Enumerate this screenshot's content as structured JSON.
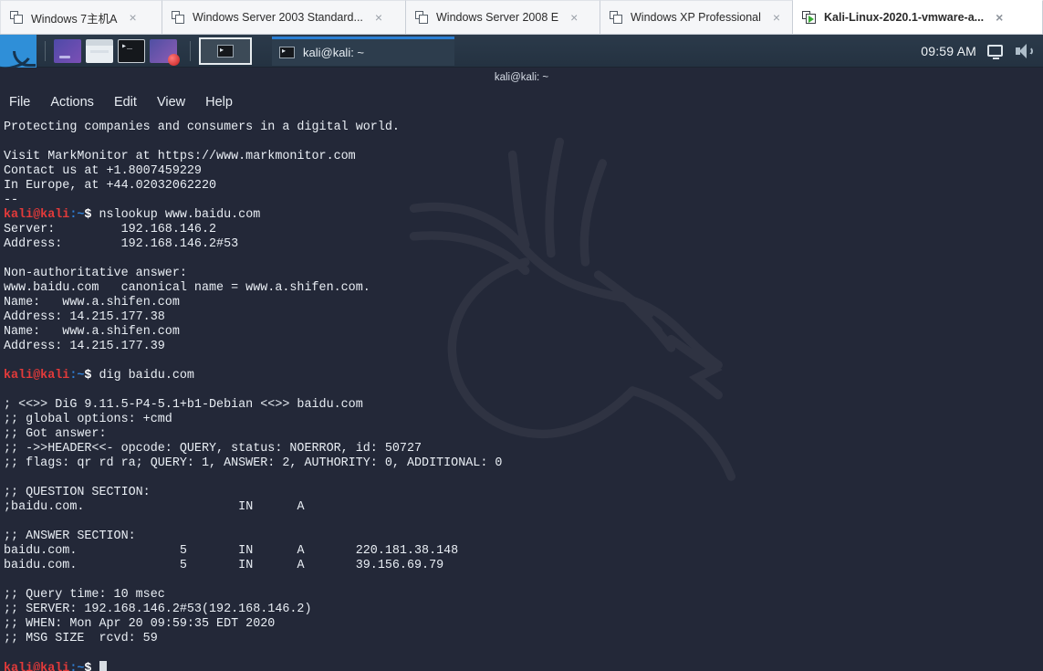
{
  "vmware_tabs": [
    {
      "label": "Windows 7主机A",
      "icon": "window-icon",
      "active": false,
      "close": "×"
    },
    {
      "label": "Windows Server 2003 Standard...",
      "icon": "window-icon",
      "active": false,
      "close": "×"
    },
    {
      "label": "Windows Server 2008 E",
      "icon": "window-icon",
      "active": false,
      "close": "×"
    },
    {
      "label": "Windows XP Professional",
      "icon": "window-icon",
      "active": false,
      "close": "×"
    },
    {
      "label": "Kali-Linux-2020.1-vmware-a...",
      "icon": "kali-play-icon",
      "active": true,
      "close": "×"
    }
  ],
  "panel": {
    "logo_name": "kali-dragon-logo",
    "launchers": [
      {
        "name": "launcher-file-manager"
      },
      {
        "name": "launcher-folder"
      },
      {
        "name": "launcher-terminal"
      },
      {
        "name": "launcher-burpsuite"
      }
    ],
    "workspace_label": "workspace-switcher",
    "task_label": "kali@kali: ~",
    "clock": "09:59 AM",
    "tray": [
      {
        "name": "display-icon"
      },
      {
        "name": "volume-icon"
      }
    ]
  },
  "window": {
    "title": "kali@kali: ~",
    "menu": [
      "File",
      "Actions",
      "Edit",
      "View",
      "Help"
    ]
  },
  "terminal": {
    "lines": [
      {
        "type": "out",
        "text": "Protecting companies and consumers in a digital world."
      },
      {
        "type": "out",
        "text": ""
      },
      {
        "type": "out",
        "text": "Visit MarkMonitor at https://www.markmonitor.com"
      },
      {
        "type": "out",
        "text": "Contact us at +1.8007459229"
      },
      {
        "type": "out",
        "text": "In Europe, at +44.02032062220"
      },
      {
        "type": "out",
        "text": "--"
      },
      {
        "type": "prompt",
        "user": "kali@kali",
        "colon": ":",
        "path": "~",
        "dollar": "$",
        "command": " nslookup www.baidu.com"
      },
      {
        "type": "out",
        "text": "Server:\t\t192.168.146.2"
      },
      {
        "type": "out",
        "text": "Address:\t192.168.146.2#53"
      },
      {
        "type": "out",
        "text": ""
      },
      {
        "type": "out",
        "text": "Non-authoritative answer:"
      },
      {
        "type": "out",
        "text": "www.baidu.com\tcanonical name = www.a.shifen.com."
      },
      {
        "type": "out",
        "text": "Name:\twww.a.shifen.com"
      },
      {
        "type": "out",
        "text": "Address: 14.215.177.38"
      },
      {
        "type": "out",
        "text": "Name:\twww.a.shifen.com"
      },
      {
        "type": "out",
        "text": "Address: 14.215.177.39"
      },
      {
        "type": "out",
        "text": ""
      },
      {
        "type": "prompt",
        "user": "kali@kali",
        "colon": ":",
        "path": "~",
        "dollar": "$",
        "command": " dig baidu.com"
      },
      {
        "type": "out",
        "text": ""
      },
      {
        "type": "out",
        "text": "; <<>> DiG 9.11.5-P4-5.1+b1-Debian <<>> baidu.com"
      },
      {
        "type": "out",
        "text": ";; global options: +cmd"
      },
      {
        "type": "out",
        "text": ";; Got answer:"
      },
      {
        "type": "out",
        "text": ";; ->>HEADER<<- opcode: QUERY, status: NOERROR, id: 50727"
      },
      {
        "type": "out",
        "text": ";; flags: qr rd ra; QUERY: 1, ANSWER: 2, AUTHORITY: 0, ADDITIONAL: 0"
      },
      {
        "type": "out",
        "text": ""
      },
      {
        "type": "out",
        "text": ";; QUESTION SECTION:"
      },
      {
        "type": "out",
        "text": ";baidu.com.\t\t\tIN\tA"
      },
      {
        "type": "out",
        "text": ""
      },
      {
        "type": "out",
        "text": ";; ANSWER SECTION:"
      },
      {
        "type": "out",
        "text": "baidu.com.\t\t5\tIN\tA\t220.181.38.148"
      },
      {
        "type": "out",
        "text": "baidu.com.\t\t5\tIN\tA\t39.156.69.79"
      },
      {
        "type": "out",
        "text": ""
      },
      {
        "type": "out",
        "text": ";; Query time: 10 msec"
      },
      {
        "type": "out",
        "text": ";; SERVER: 192.168.146.2#53(192.168.146.2)"
      },
      {
        "type": "out",
        "text": ";; WHEN: Mon Apr 20 09:59:35 EDT 2020"
      },
      {
        "type": "out",
        "text": ";; MSG SIZE  rcvd: 59"
      },
      {
        "type": "out",
        "text": ""
      },
      {
        "type": "prompt",
        "user": "kali@kali",
        "colon": ":",
        "path": "~",
        "dollar": "$",
        "command": " ",
        "cursor": true
      }
    ]
  },
  "colors": {
    "terminal_bg": "#232838",
    "panel_bg": "#2b3a4a",
    "tabbar_bg": "#eceef1",
    "prompt_user": "#e33a3a",
    "prompt_path": "#2f7fd6",
    "text": "#e9eef4",
    "accent_blue": "#2a7fd4",
    "kali_green": "#39a935"
  }
}
